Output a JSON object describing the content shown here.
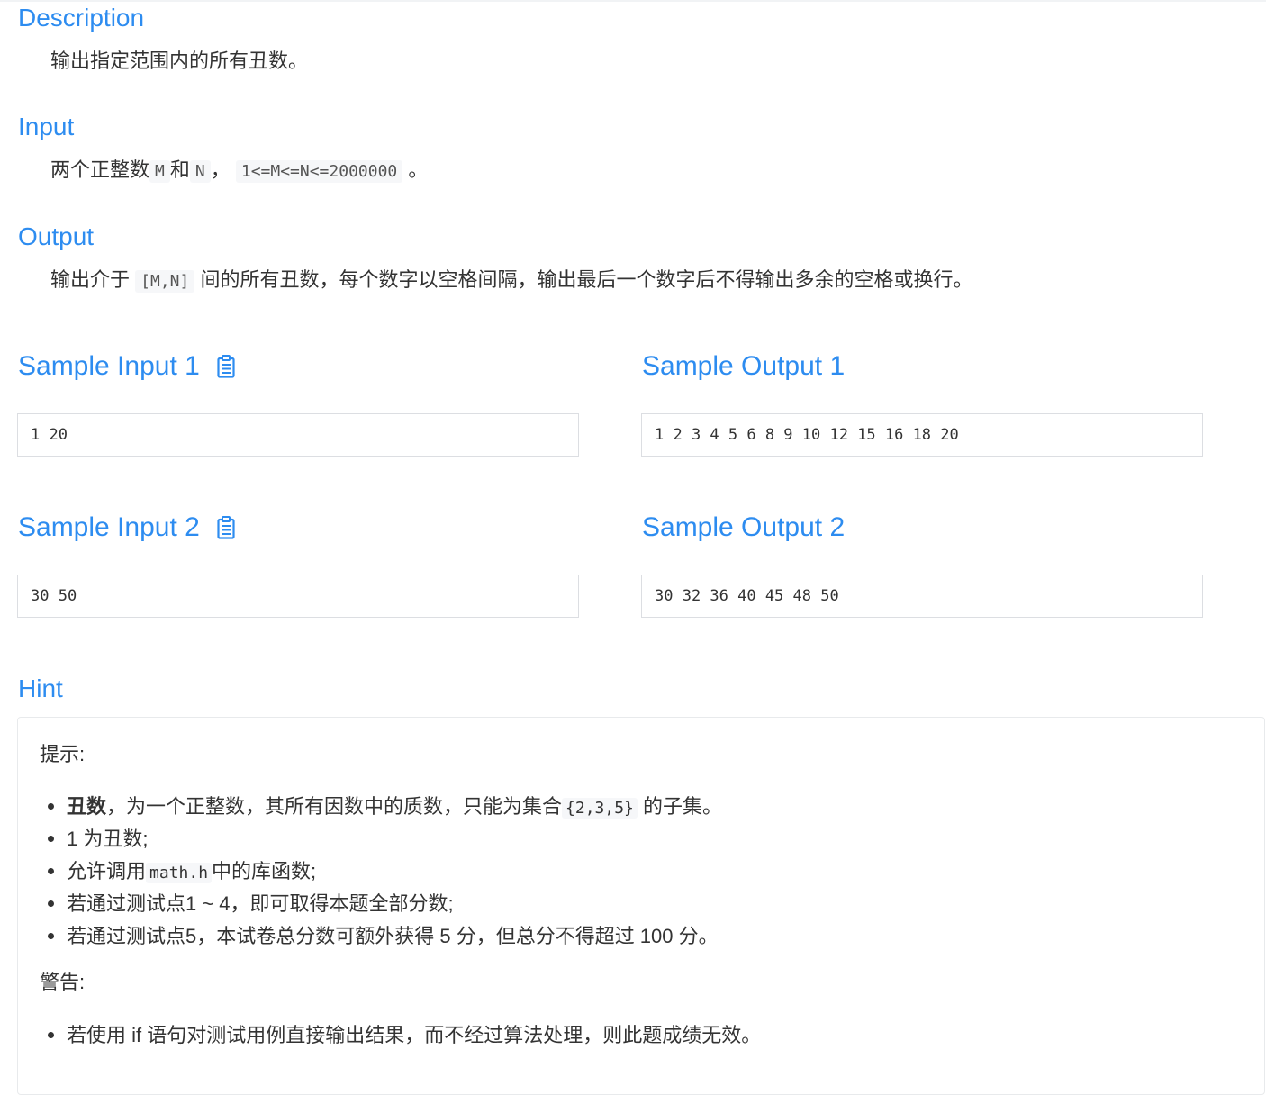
{
  "description": {
    "title": "Description",
    "text": "输出指定范围内的所有丑数。"
  },
  "input": {
    "title": "Input",
    "pre": "两个正整数",
    "code1": "M",
    "mid": "和",
    "code2": "N",
    "sep": "，",
    "code3": "1<=M<=N<=2000000",
    "post": "。"
  },
  "output": {
    "title": "Output",
    "pre": "输出介于",
    "code": "[M,N]",
    "post": "间的所有丑数，每个数字以空格间隔，输出最后一个数字后不得输出多余的空格或换行。"
  },
  "samples": [
    {
      "input_title": "Sample Input 1",
      "input_value": "1 20",
      "output_title": "Sample Output 1",
      "output_value": "1 2 3 4 5 6 8 9 10 12 15 16 18 20"
    },
    {
      "input_title": "Sample Input 2",
      "input_value": "30 50",
      "output_title": "Sample Output 2",
      "output_value": "30 32 36 40 45 48 50"
    }
  ],
  "copy_icon": "clipboard-icon",
  "hint": {
    "title": "Hint",
    "tip_label": "提示:",
    "item1_bold": "丑数",
    "item1_text": "，为一个正整数，其所有因数中的质数，只能为集合",
    "item1_code": "{2,3,5}",
    "item1_post": "的子集。",
    "item2": "1 为丑数;",
    "item3_pre": "允许调用",
    "item3_code": "math.h",
    "item3_post": "中的库函数;",
    "item4": "若通过测试点1 ~ 4，即可取得本题全部分数;",
    "item5": "若通过测试点5，本试卷总分数可额外获得 5 分，但总分不得超过 100 分。",
    "warning_label": "警告:",
    "warning_item": "若使用 if 语句对测试用例直接输出结果，而不经过算法处理，则此题成绩无效。"
  },
  "colors": {
    "accent": "#2d8cf0",
    "text": "#333333",
    "code_bg": "#f6f7f9",
    "border": "#dcdee2"
  }
}
